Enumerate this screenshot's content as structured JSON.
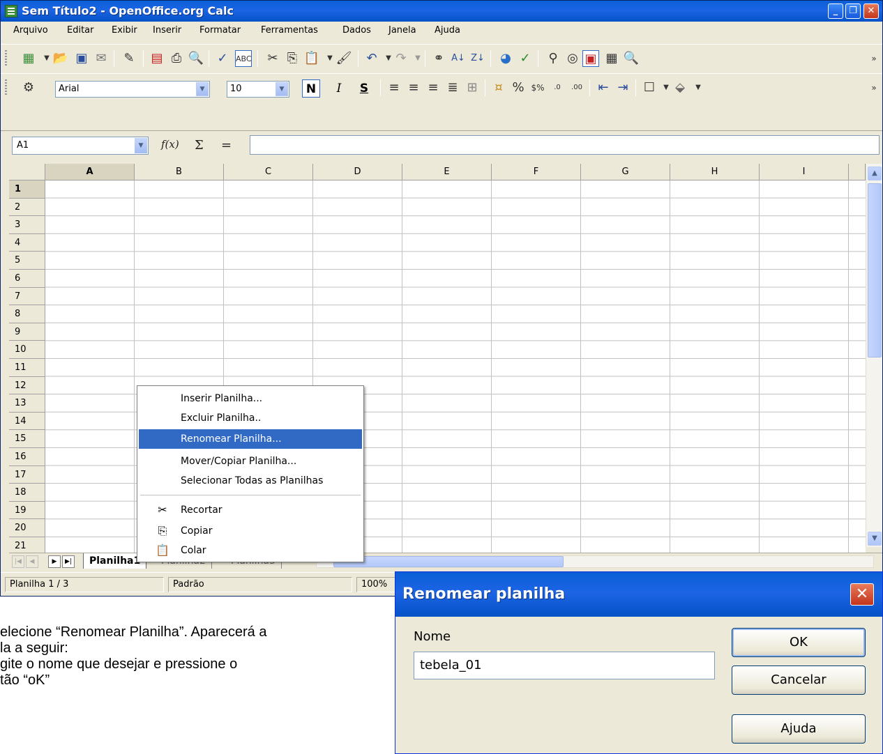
{
  "window": {
    "title": "Sem Título2 - OpenOffice.org Calc",
    "controls": [
      "_",
      "❐",
      "✕"
    ]
  },
  "menubar": [
    "Arquivo",
    "Editar",
    "Exibir",
    "Inserir",
    "Formatar",
    "Ferramentas",
    "Dados",
    "Janela",
    "Ajuda"
  ],
  "format_toolbar": {
    "font_name": "Arial",
    "font_size": "10",
    "bold_label": "N",
    "italic_label": "I",
    "underline_label": "S"
  },
  "formula_bar": {
    "cell_ref": "A1",
    "fx_label": "f(x)",
    "sum_label": "Σ",
    "equals_label": "=",
    "formula_value": ""
  },
  "grid": {
    "columns": [
      "A",
      "B",
      "C",
      "D",
      "E",
      "F",
      "G",
      "H",
      "I"
    ],
    "rows": [
      "1",
      "2",
      "3",
      "4",
      "5",
      "6",
      "7",
      "8",
      "9",
      "10",
      "11",
      "12",
      "13",
      "14",
      "15",
      "16",
      "17",
      "18",
      "19",
      "20",
      "21"
    ],
    "selected_column": "A",
    "selected_row": "1"
  },
  "sheet_tabs": {
    "active": "Planilha1",
    "others": [
      "Planilha2",
      "Planilha3"
    ]
  },
  "statusbar": {
    "sheet": "Planilha 1 / 3",
    "style": "Padrão",
    "zoom": "100%"
  },
  "context_menu": {
    "items": [
      {
        "label": "Inserir Planilha...",
        "icon": ""
      },
      {
        "label": "Excluir Planilha..",
        "icon": ""
      },
      {
        "label": "Renomear Planilha...",
        "icon": "",
        "highlighted": true
      },
      {
        "label": "Mover/Copiar Planilha...",
        "icon": ""
      },
      {
        "label": "Selecionar Todas as Planilhas",
        "icon": ""
      },
      {
        "label": "Recortar",
        "icon": "scissors-icon"
      },
      {
        "label": "Copiar",
        "icon": "copy-icon"
      },
      {
        "label": "Colar",
        "icon": "paste-icon"
      }
    ]
  },
  "doc_text": {
    "line1": "elecione “Renomear Planilha”. Aparecerá a",
    "line2": "la a seguir:",
    "line3": "gite o nome que desejar e pressione o",
    "line4": "tão “oK”"
  },
  "dialog": {
    "title": "Renomear planilha",
    "name_label": "Nome",
    "name_value": "tebela_01",
    "ok_label": "OK",
    "cancel_label": "Cancelar",
    "help_label": "Ajuda"
  }
}
